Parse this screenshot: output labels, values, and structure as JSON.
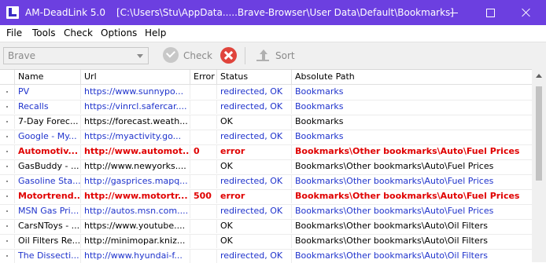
{
  "window": {
    "title": "AM-DeadLink 5.0",
    "path": "[C:\\Users\\Stu\\AppData.....Brave-Browser\\User Data\\Default\\Bookmarks]"
  },
  "menu": [
    "File",
    "Tools",
    "Check",
    "Options",
    "Help"
  ],
  "toolbar": {
    "browser_value": "Brave",
    "check_label": "Check",
    "sort_label": "Sort"
  },
  "columns": [
    "Name",
    "Url",
    "Error",
    "Status",
    "Absolute Path"
  ],
  "rows": [
    {
      "name": "PV",
      "url": "https://www.sunnypo...",
      "error": "",
      "status": "redirected, OK",
      "path": "Bookmarks",
      "kind": "redirected"
    },
    {
      "name": "Recalls",
      "url": "https://vinrcl.safercar....",
      "error": "",
      "status": "redirected, OK",
      "path": "Bookmarks",
      "kind": "redirected"
    },
    {
      "name": "7-Day Forec...",
      "url": "https://forecast.weath...",
      "error": "",
      "status": "OK",
      "path": "Bookmarks",
      "kind": "ok"
    },
    {
      "name": "Google - My...",
      "url": "https://myactivity.go...",
      "error": "",
      "status": "redirected, OK",
      "path": "Bookmarks",
      "kind": "redirected"
    },
    {
      "name": "Automotiv...",
      "url": "http://www.automot...",
      "error": "0",
      "status": "error",
      "path": "Bookmarks\\Other bookmarks\\Auto\\Fuel Prices",
      "kind": "error"
    },
    {
      "name": "GasBuddy - ...",
      "url": "http://www.newyorks....",
      "error": "",
      "status": "OK",
      "path": "Bookmarks\\Other bookmarks\\Auto\\Fuel Prices",
      "kind": "ok"
    },
    {
      "name": "Gasoline Sta...",
      "url": "http://gasprices.mapq...",
      "error": "",
      "status": "redirected, OK",
      "path": "Bookmarks\\Other bookmarks\\Auto\\Fuel Prices",
      "kind": "redirected"
    },
    {
      "name": "Motortrend...",
      "url": "http://www.motortr...",
      "error": "500",
      "status": "error",
      "path": "Bookmarks\\Other bookmarks\\Auto\\Fuel Prices",
      "kind": "error"
    },
    {
      "name": "MSN Gas Pri...",
      "url": "http://autos.msn.com....",
      "error": "",
      "status": "redirected, OK",
      "path": "Bookmarks\\Other bookmarks\\Auto\\Fuel Prices",
      "kind": "redirected"
    },
    {
      "name": "CarsNToys - ...",
      "url": "https://www.youtube....",
      "error": "",
      "status": "OK",
      "path": "Bookmarks\\Other bookmarks\\Auto\\Oil Filters",
      "kind": "ok"
    },
    {
      "name": "Oil Filters Re...",
      "url": "http://minimopar.kniz...",
      "error": "",
      "status": "OK",
      "path": "Bookmarks\\Other bookmarks\\Auto\\Oil Filters",
      "kind": "ok"
    },
    {
      "name": "The Dissecti...",
      "url": "http://www.hyundai-f...",
      "error": "",
      "status": "redirected, OK",
      "path": "Bookmarks\\Other bookmarks\\Auto\\Oil Filters",
      "kind": "redirected"
    }
  ],
  "colors": {
    "titlebar": "#6c3fe0",
    "redirected_text": "#1f33cc",
    "error_text": "#e00000"
  }
}
